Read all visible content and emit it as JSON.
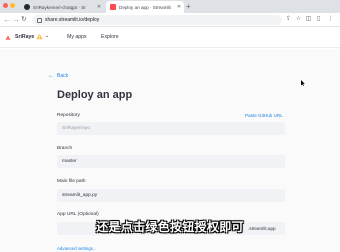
{
  "browser": {
    "tabs": [
      {
        "title": "SriRaykemeri-chatgpt · Sr"
      },
      {
        "title": "Deploy an app · Streamlit"
      }
    ],
    "new_tab_glyph": "+",
    "url": "share.streamlit.io/deploy"
  },
  "header": {
    "workspace": "SriRaye",
    "nav": {
      "my_apps": "My apps",
      "explore": "Explore"
    },
    "colors": {
      "brand": "#ff4b4b",
      "warning": "#ffbd45"
    }
  },
  "form": {
    "back_label": "Back",
    "title": "Deploy an app",
    "repository": {
      "label": "Repository",
      "placeholder": "SriRaye/repo",
      "paste_link": "Paste GitHub URL"
    },
    "branch": {
      "label": "Branch",
      "value": "master"
    },
    "main_file": {
      "label": "Main file path",
      "value": "streamlit_app.py"
    },
    "app_url": {
      "label": "App URL (Optional)",
      "suffix": ".streamlit.app"
    },
    "advanced_link": "Advanced settings..."
  },
  "subtitle": "还是点击绿色按钮授权即可",
  "colors": {
    "accent": "#1c83e1",
    "input_bg": "#f0f2f6",
    "text": "#31333f"
  }
}
